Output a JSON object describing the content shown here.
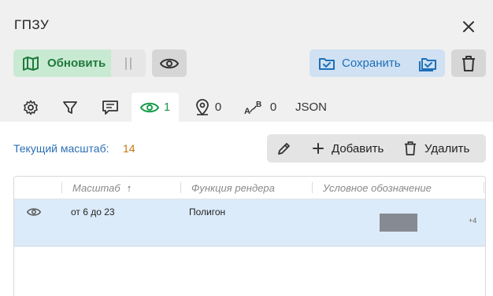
{
  "header": {
    "title": "ГПЗУ"
  },
  "toolbar": {
    "update_label": "Обновить",
    "save_label": "Сохранить"
  },
  "tabs": [
    {
      "icon": "gear-icon",
      "count": ""
    },
    {
      "icon": "filter-icon",
      "count": ""
    },
    {
      "icon": "comment-icon",
      "count": ""
    },
    {
      "icon": "eye-icon",
      "count": "1"
    },
    {
      "icon": "map-pin-icon",
      "count": "0"
    },
    {
      "icon": "label-icon",
      "count": "0"
    },
    {
      "label": "JSON"
    }
  ],
  "scale": {
    "label": "Текущий масштаб:",
    "value": "14"
  },
  "actions": {
    "add_label": "Добавить",
    "delete_label": "Удалить"
  },
  "table": {
    "columns": [
      "Масштаб",
      "Функция рендера",
      "Условное обозначение"
    ],
    "sort_indicator": "↑",
    "rows": [
      {
        "scale": "от 6 до 23",
        "render_function": "Полигон",
        "more": "+4",
        "swatch_color": "#868b93"
      }
    ]
  },
  "colors": {
    "accent_green": "#1a9b4b",
    "accent_blue": "#1e6fb8",
    "selected_row": "#dcebf9"
  }
}
